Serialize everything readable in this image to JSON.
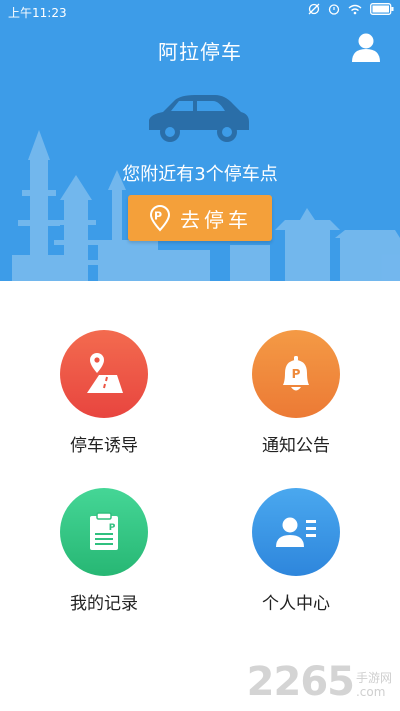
{
  "status_bar": {
    "time": "上午11:23"
  },
  "header": {
    "title": "阿拉停车",
    "user_icon": "user-icon"
  },
  "hero": {
    "nearby_text": "您附近有3个停车点",
    "go_button_label": "去停车",
    "go_button_icon": "parking-pin-icon",
    "accent": "#3d9ce8",
    "button_color": "#f4a03a"
  },
  "menu": [
    {
      "label": "停车诱导",
      "icon": "map-pin-road-icon",
      "color": "#ef5d47"
    },
    {
      "label": "通知公告",
      "icon": "bell-icon",
      "color": "#f08a3e"
    },
    {
      "label": "我的记录",
      "icon": "clipboard-icon",
      "color": "#34c584"
    },
    {
      "label": "个人中心",
      "icon": "profile-card-icon",
      "color": "#2e8fe0"
    }
  ],
  "watermark": {
    "number": "2265",
    "suffix": "手游网",
    "domain": ".com"
  }
}
